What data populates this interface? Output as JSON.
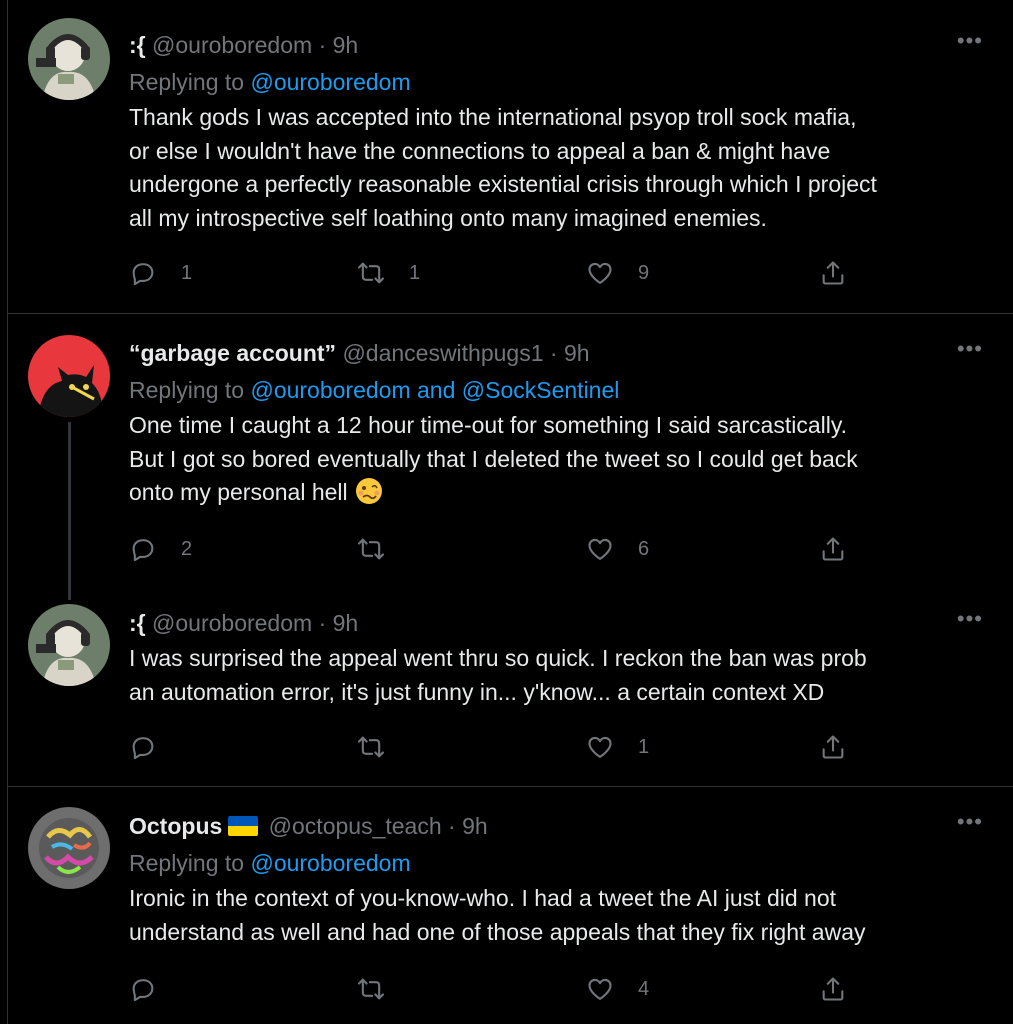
{
  "tweets": [
    {
      "name": ":{",
      "handle": "@ouroboredom",
      "time": "9h",
      "replying_prefix": "Replying to ",
      "replying_to": "@ouroboredom",
      "text_lines": [
        "Thank gods I was accepted into the international psyop troll sock mafia,",
        "or else I wouldn't have the connections to appeal a ban & might have",
        "undergone a perfectly reasonable existential crisis through which I project",
        "all my introspective self loathing onto many imagined enemies."
      ],
      "replies": "1",
      "retweets": "1",
      "likes": "9"
    },
    {
      "name": "“garbage account”",
      "handle": "@danceswithpugs1",
      "time": "9h",
      "replying_prefix": "Replying to ",
      "replying_to": "@ouroboredom and @SockSentinel",
      "text_lines": [
        "One time I caught a 12 hour time-out for something I said sarcastically.",
        "But I got so bored eventually that I deleted the tweet so I could get back",
        "onto my personal hell"
      ],
      "emoji": "woozy-face-emoji",
      "replies": "2",
      "retweets": "",
      "likes": "6"
    },
    {
      "name": ":{",
      "handle": "@ouroboredom",
      "time": "9h",
      "text_lines": [
        "I was surprised the appeal went thru so quick. I reckon the ban was prob",
        "an automation error, it's just funny in... y'know... a certain context XD"
      ],
      "replies": "",
      "retweets": "",
      "likes": "1"
    },
    {
      "name": "Octopus",
      "flag": "ukraine-flag",
      "handle": "@octopus_teach",
      "time": "9h",
      "replying_prefix": "Replying to ",
      "replying_to": "@ouroboredom",
      "text_lines": [
        "Ironic in the context of you-know-who.  I had a tweet the  AI just did not",
        "understand as well and had one of those appeals that they fix right away"
      ],
      "replies": "",
      "retweets": "",
      "likes": "4"
    }
  ],
  "ui": {
    "dot": "·",
    "more": "•••"
  },
  "colors": {
    "background": "#000000",
    "text": "#e7e9ea",
    "muted": "#71767b",
    "link": "#1d9bf0",
    "divider": "#2f3336"
  }
}
